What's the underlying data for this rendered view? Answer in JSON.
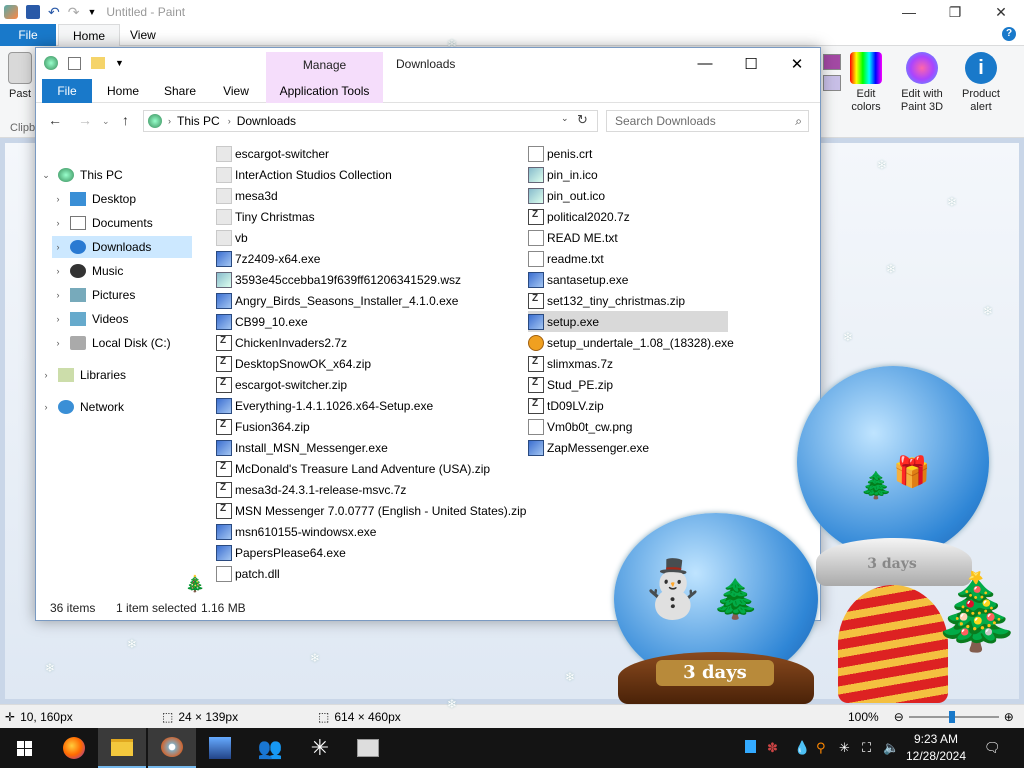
{
  "paint": {
    "title": "Untitled - Paint",
    "tabs": {
      "file": "File",
      "home": "Home",
      "view": "View"
    },
    "ribbon": {
      "paste": "Past",
      "clipboard": "Clipb",
      "edit_colors": "Edit colors",
      "edit_paint3d": "Edit with Paint 3D",
      "product_alert": "Product alert"
    },
    "status": {
      "cursor_pos": "10, 160px",
      "selection_size": "24 × 139px",
      "image_size": "614 × 460px",
      "zoom": "100%"
    }
  },
  "explorer": {
    "manage": "Manage",
    "title": "Downloads",
    "tabs": {
      "file": "File",
      "home": "Home",
      "share": "Share",
      "view": "View",
      "app_tools": "Application Tools"
    },
    "address": {
      "root": "This PC",
      "current": "Downloads"
    },
    "search_placeholder": "Search Downloads",
    "nav": [
      {
        "label": "This PC",
        "level": 0,
        "expanded": true
      },
      {
        "label": "Desktop",
        "level": 1
      },
      {
        "label": "Documents",
        "level": 1
      },
      {
        "label": "Downloads",
        "level": 1,
        "selected": true
      },
      {
        "label": "Music",
        "level": 1
      },
      {
        "label": "Pictures",
        "level": 1
      },
      {
        "label": "Videos",
        "level": 1
      },
      {
        "label": "Local Disk (C:)",
        "level": 1
      },
      {
        "label": "Libraries",
        "level": 0
      },
      {
        "label": "Network",
        "level": 0
      }
    ],
    "files_col1": [
      {
        "name": "escargot-switcher",
        "type": "folder"
      },
      {
        "name": "InterAction Studios Collection",
        "type": "folder"
      },
      {
        "name": "mesa3d",
        "type": "folder"
      },
      {
        "name": "Tiny Christmas",
        "type": "folder"
      },
      {
        "name": "vb",
        "type": "folder"
      },
      {
        "name": "7z2409-x64.exe",
        "type": "exe"
      },
      {
        "name": "3593e45ccebba19f639ff61206341529.wsz",
        "type": "img"
      },
      {
        "name": "Angry_Birds_Seasons_Installer_4.1.0.exe",
        "type": "exe"
      },
      {
        "name": "CB99_10.exe",
        "type": "exe"
      },
      {
        "name": "ChickenInvaders2.7z",
        "type": "zip"
      },
      {
        "name": "DesktopSnowOK_x64.zip",
        "type": "zip"
      },
      {
        "name": "escargot-switcher.zip",
        "type": "zip"
      },
      {
        "name": "Everything-1.4.1.1026.x64-Setup.exe",
        "type": "exe"
      },
      {
        "name": "Fusion364.zip",
        "type": "zip"
      },
      {
        "name": "Install_MSN_Messenger.exe",
        "type": "exe"
      },
      {
        "name": "McDonald's Treasure Land Adventure (USA).zip",
        "type": "zip"
      },
      {
        "name": "mesa3d-24.3.1-release-msvc.7z",
        "type": "zip"
      },
      {
        "name": "MSN Messenger 7.0.0777 (English - United States).zip",
        "type": "zip"
      },
      {
        "name": "msn610155-windowsx.exe",
        "type": "exe"
      },
      {
        "name": "PapersPlease64.exe",
        "type": "exe"
      },
      {
        "name": "patch.dll",
        "type": "txt"
      }
    ],
    "files_col2": [
      {
        "name": "penis.crt",
        "type": "txt"
      },
      {
        "name": "pin_in.ico",
        "type": "img"
      },
      {
        "name": "pin_out.ico",
        "type": "img"
      },
      {
        "name": "political2020.7z",
        "type": "zip"
      },
      {
        "name": "READ ME.txt",
        "type": "txt"
      },
      {
        "name": "readme.txt",
        "type": "txt"
      },
      {
        "name": "santasetup.exe",
        "type": "exe"
      },
      {
        "name": "set132_tiny_christmas.zip",
        "type": "zip"
      },
      {
        "name": "setup.exe",
        "type": "exe",
        "selected": true
      },
      {
        "name": "setup_undertale_1.08_(18328).exe",
        "type": "gear"
      },
      {
        "name": "slimxmas.7z",
        "type": "zip"
      },
      {
        "name": "Stud_PE.zip",
        "type": "zip"
      },
      {
        "name": "tD09LV.zip",
        "type": "zip"
      },
      {
        "name": "Vm0b0t_cw.png",
        "type": "txt"
      },
      {
        "name": "ZapMessenger.exe",
        "type": "exe"
      }
    ],
    "status": {
      "items": "36 items",
      "selected": "1 item selected",
      "size": "1.16 MB"
    }
  },
  "desktop": {
    "globe1_days": "3 days",
    "globe2_days": "3 days"
  },
  "taskbar": {
    "time": "9:23 AM",
    "date": "12/28/2024"
  },
  "colors": {
    "accent": "#1979ca",
    "selection": "#cce8ff",
    "manage": "#f5ddfb",
    "taskbar": "#141414"
  }
}
